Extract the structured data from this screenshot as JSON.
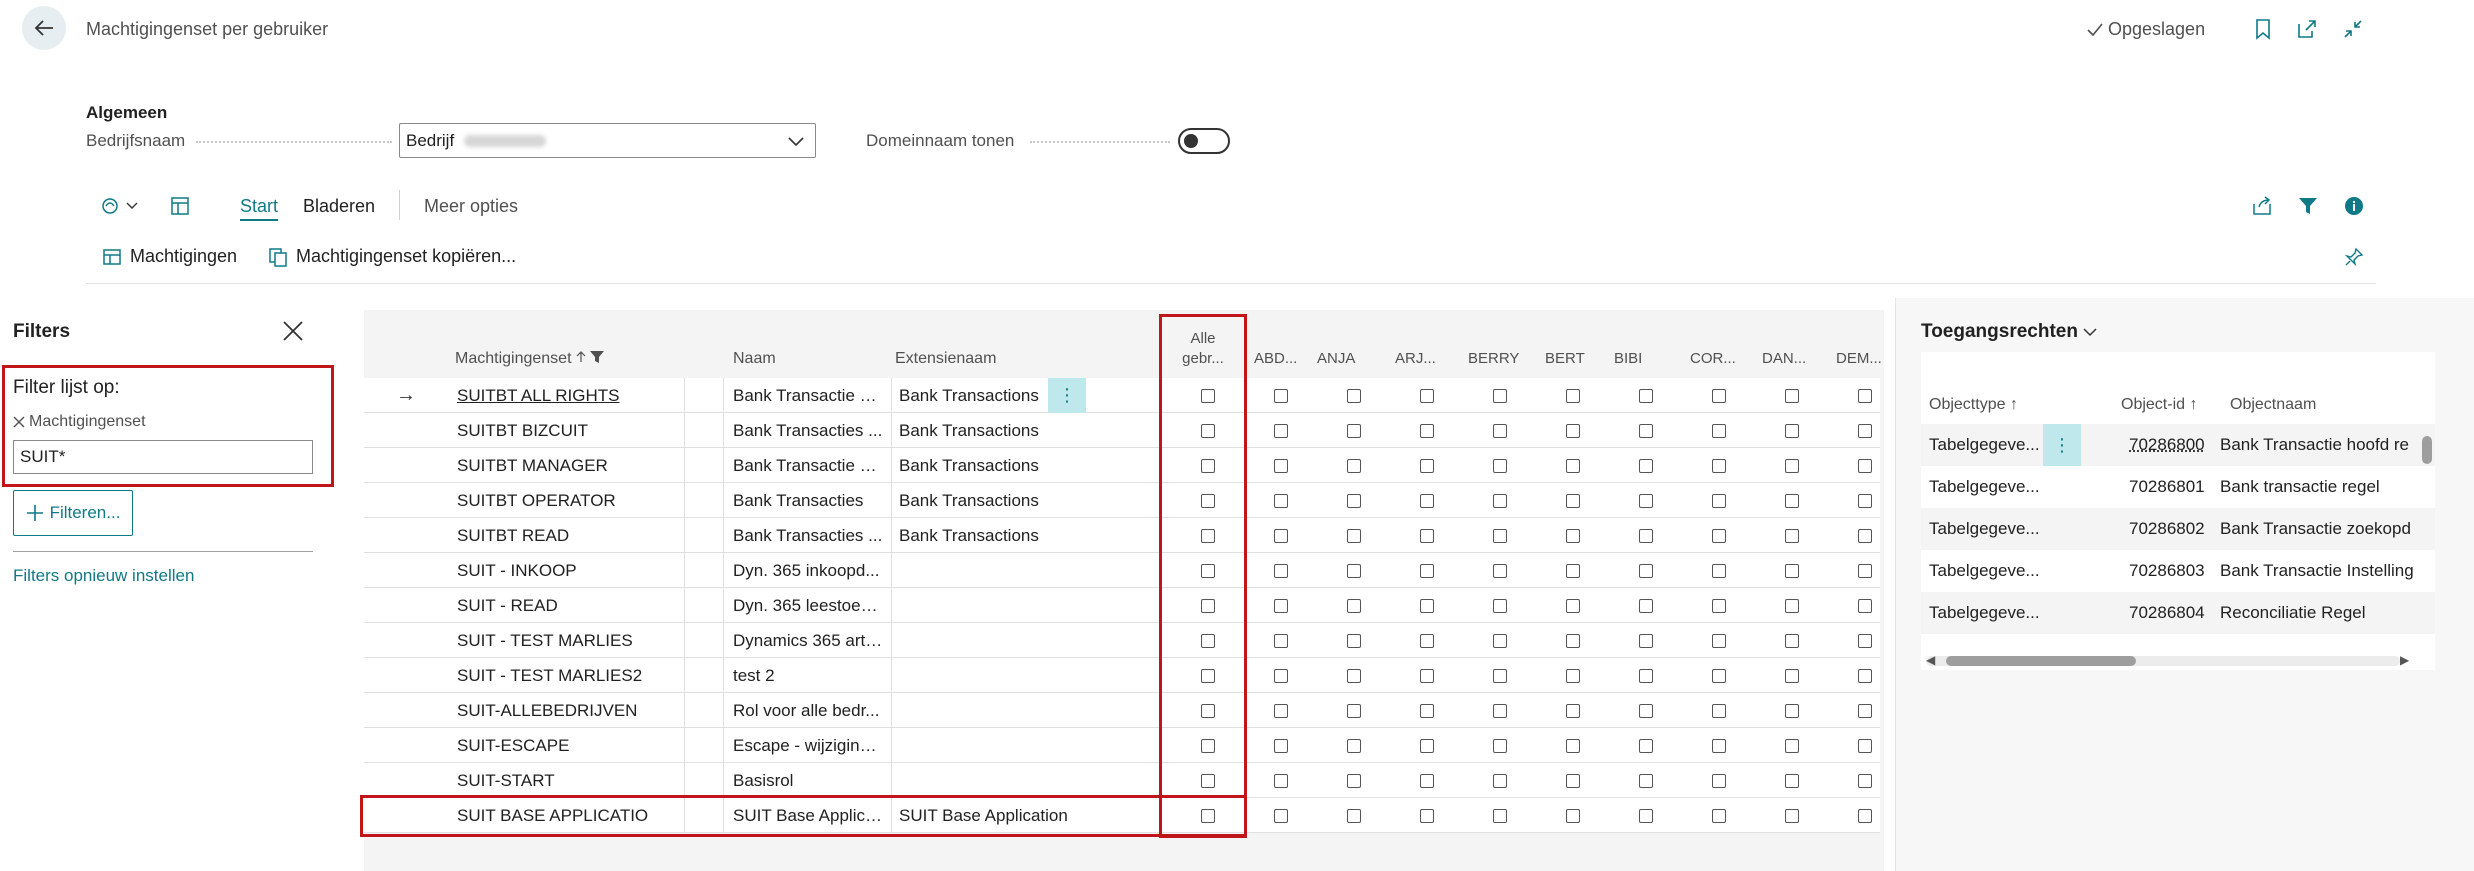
{
  "header": {
    "title": "Machtigingenset per gebruiker",
    "status": "Opgeslagen"
  },
  "general": {
    "section_title": "Algemeen",
    "company_label": "Bedrijfsnaam",
    "company_value": "Bedrijf",
    "domain_label": "Domeinnaam tonen",
    "domain_toggle_on": false
  },
  "actions": {
    "tabs": [
      "Start",
      "Bladeren",
      "Meer opties"
    ],
    "buttons": [
      "Machtigingen",
      "Machtigingenset kopiëren..."
    ]
  },
  "filters": {
    "title": "Filters",
    "heading": "Filter lijst op:",
    "field_name": "Machtigingenset",
    "field_value": "SUIT*",
    "add_label": "Filteren...",
    "reset_label": "Filters opnieuw instellen"
  },
  "grid": {
    "columns": {
      "set": "Machtigingenset",
      "name": "Naam",
      "extension": "Extensienaam",
      "all_users_line1": "Alle",
      "all_users_line2": "gebr..."
    },
    "user_columns": [
      "ABD...",
      "ANJA",
      "ARJ...",
      "BERRY",
      "BERT",
      "BIBI",
      "COR...",
      "DAN...",
      "DEM..."
    ],
    "rows": [
      {
        "set": "SUITBT ALL RIGHTS",
        "name": "Bank Transactie d...",
        "extension": "Bank Transactions"
      },
      {
        "set": "SUITBT BIZCUIT",
        "name": "Bank Transacties ...",
        "extension": "Bank Transactions"
      },
      {
        "set": "SUITBT MANAGER",
        "name": "Bank Transactie B...",
        "extension": "Bank Transactions"
      },
      {
        "set": "SUITBT OPERATOR",
        "name": "Bank Transacties",
        "extension": "Bank Transactions"
      },
      {
        "set": "SUITBT READ",
        "name": "Bank Transacties ...",
        "extension": "Bank Transactions"
      },
      {
        "set": "SUIT - INKOOP",
        "name": "Dyn. 365 inkoopd...",
        "extension": ""
      },
      {
        "set": "SUIT - READ",
        "name": "Dyn. 365 leestoeg...",
        "extension": ""
      },
      {
        "set": "SUIT - TEST MARLIES",
        "name": "Dynamics 365 arti...",
        "extension": ""
      },
      {
        "set": "SUIT - TEST MARLIES2",
        "name": "test 2",
        "extension": ""
      },
      {
        "set": "SUIT-ALLEBEDRIJVEN",
        "name": "Rol voor alle bedr...",
        "extension": ""
      },
      {
        "set": "SUIT-ESCAPE",
        "name": "Escape - wijziging...",
        "extension": ""
      },
      {
        "set": "SUIT-START",
        "name": "Basisrol",
        "extension": ""
      },
      {
        "set": "SUIT BASE APPLICATIO",
        "name": "SUIT Base Applica...",
        "extension": "SUIT Base Application"
      }
    ]
  },
  "factbox": {
    "title": "Toegangsrechten",
    "columns": {
      "type": "Objecttype",
      "id": "Object-id",
      "name": "Objectnaam"
    },
    "rows": [
      {
        "type": "Tabelgegeve...",
        "id": "70286800",
        "name": "Bank Transactie hoofd re"
      },
      {
        "type": "Tabelgegeve...",
        "id": "70286801",
        "name": "Bank transactie regel"
      },
      {
        "type": "Tabelgegeve...",
        "id": "70286802",
        "name": "Bank Transactie zoekopd"
      },
      {
        "type": "Tabelgegeve...",
        "id": "70286803",
        "name": "Bank Transactie Instelling"
      },
      {
        "type": "Tabelgegeve...",
        "id": "70286804",
        "name": "Reconciliatie Regel"
      }
    ]
  },
  "colors": {
    "accent": "#0f7a86",
    "highlight": "#c0161a",
    "row_menu": "#bfe8ec"
  }
}
